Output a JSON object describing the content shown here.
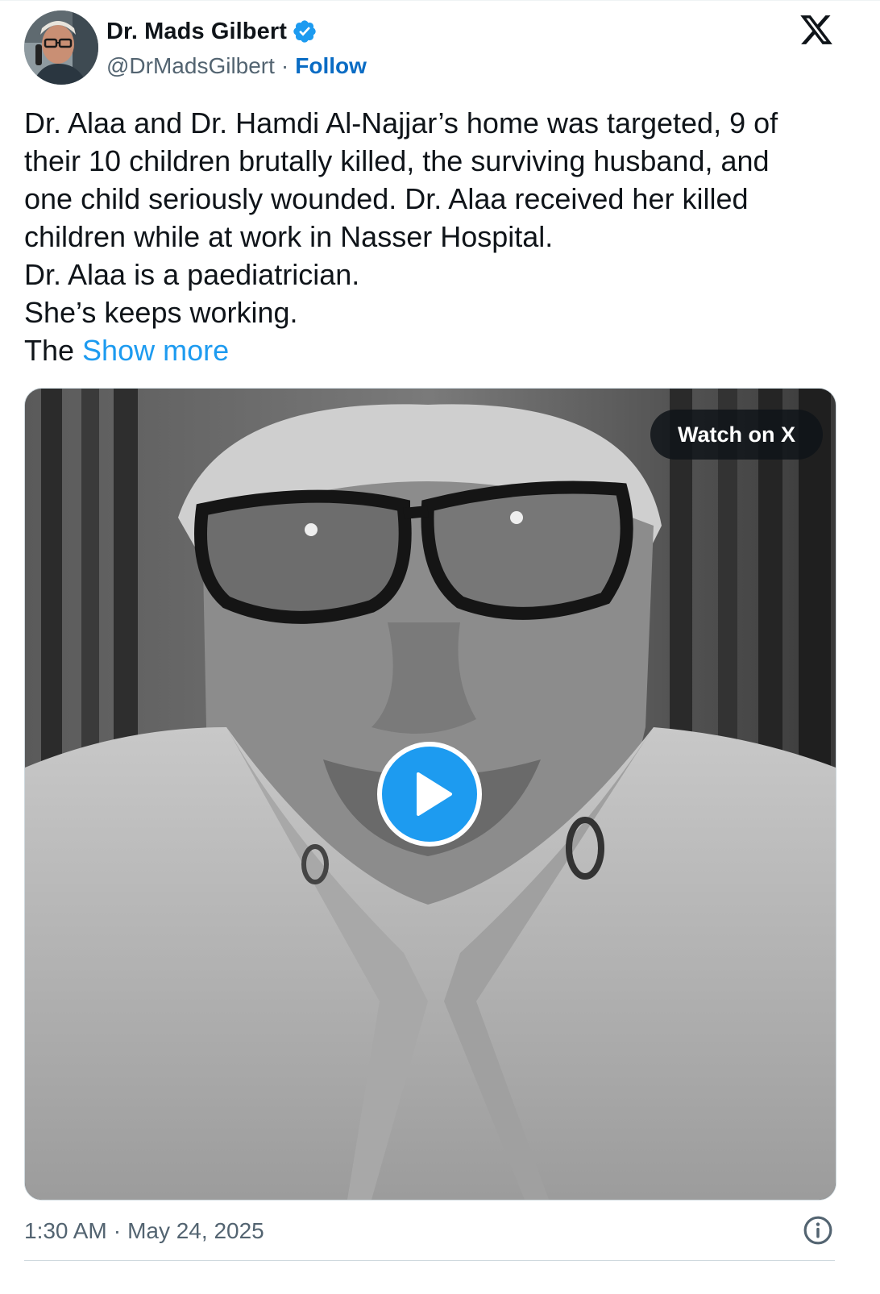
{
  "author": {
    "display_name": "Dr. Mads Gilbert",
    "handle": "@DrMadsGilbert",
    "separator": "·",
    "follow_label": "Follow",
    "verified": true
  },
  "brand": {
    "logo_icon": "x-logo-icon",
    "accent_color": "#1d9bf0"
  },
  "tweet": {
    "lines": [
      "Dr. Alaa and Dr. Hamdi Al-Najjar’s home was targeted, 9 of",
      "their 10 children brutally killed, the surviving husband, and",
      "one child seriously wounded. Dr. Alaa received her killed",
      "children while at work in Nasser Hospital.",
      "Dr. Alaa is a paediatrician.",
      "She’s  keeps working."
    ],
    "last_line_prefix": "The ",
    "show_more_label": "Show more"
  },
  "media": {
    "type": "video",
    "watch_label": "Watch on X",
    "play_icon": "play-icon"
  },
  "footer": {
    "time": "1:30 AM",
    "separator": "·",
    "date": "May 24, 2025",
    "info_icon": "info-icon"
  }
}
